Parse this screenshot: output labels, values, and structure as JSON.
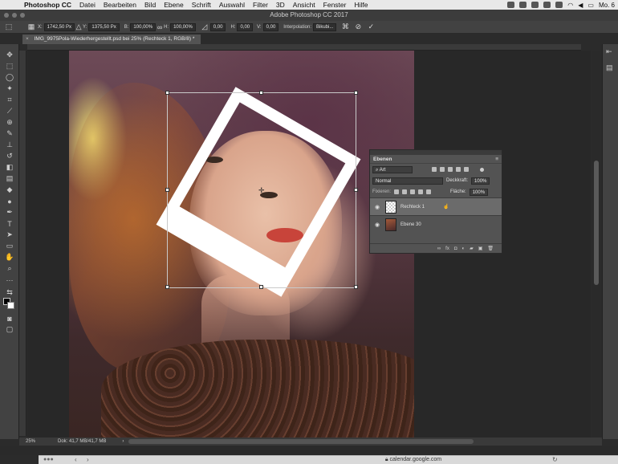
{
  "menubar": {
    "app": "Photoshop CC",
    "items": [
      "Datei",
      "Bearbeiten",
      "Bild",
      "Ebene",
      "Schrift",
      "Auswahl",
      "Filter",
      "3D",
      "Ansicht",
      "Fenster",
      "Hilfe"
    ],
    "clock": "Mo. 6"
  },
  "window": {
    "title": "Adobe Photoshop CC 2017"
  },
  "options": {
    "x_label": "X:",
    "x_value": "1742,50 Px",
    "y_label": "Y:",
    "y_value": "1375,50 Px",
    "b_label": "B:",
    "b_value": "100,00%",
    "h_label": "H:",
    "h_value": "100,00%",
    "angle_value": "0,00",
    "hskew_label": "H:",
    "hskew_value": "0,00",
    "vskew_label": "V:",
    "vskew_value": "0,00",
    "interp_label": "Interpolation:",
    "interp_value": "Bikubi..."
  },
  "document": {
    "tab_title": "IMG_9975Pola-Wiederhergestellt.psd bei 25% (Rechteck 1, RGB/8) *"
  },
  "layers_panel": {
    "tab": "Ebenen",
    "search_placeholder": "Art",
    "blend_mode": "Normal",
    "opacity_label": "Deckkraft:",
    "opacity_value": "100%",
    "lock_label": "Fixieren:",
    "fill_label": "Fläche:",
    "fill_value": "100%",
    "layers": [
      {
        "name": "Rechteck 1",
        "active": true
      },
      {
        "name": "Ebene 30",
        "active": false
      }
    ]
  },
  "status": {
    "zoom": "25%",
    "doc": "Dok: 41,7 MB/41,7 MB"
  },
  "browser": {
    "url": "calendar.google.com"
  }
}
